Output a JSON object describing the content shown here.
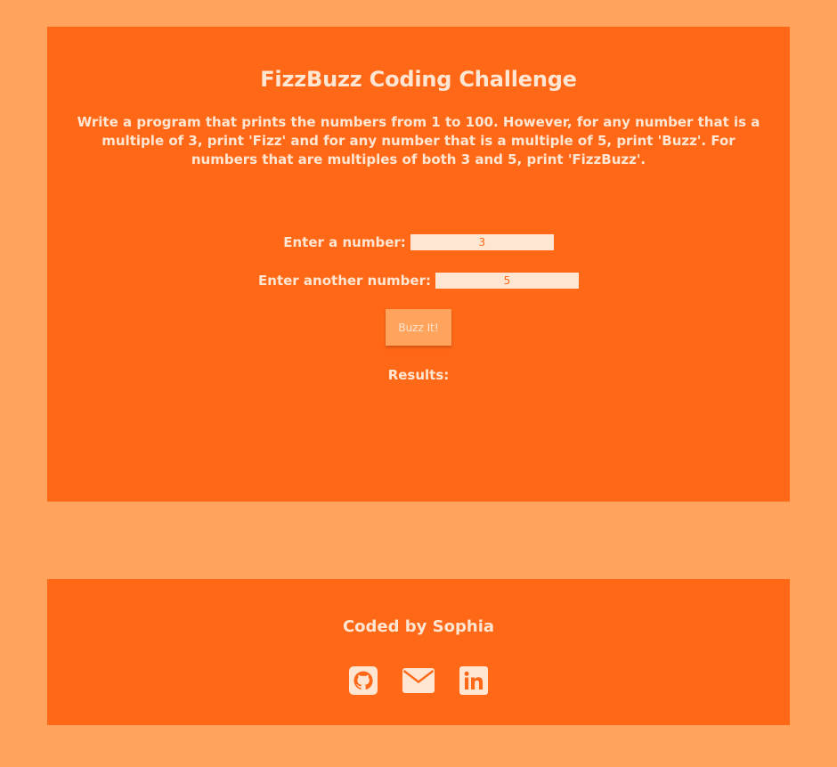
{
  "challenge": {
    "title": "FizzBuzz Coding Challenge",
    "description": "Write a program that prints the numbers from 1 to 100. However, for any number that is a multiple of 3, print 'Fizz' and for any number that is a multiple of 5, print 'Buzz'. For numbers that are multiples of both 3 and 5, print 'FizzBuzz'."
  },
  "form": {
    "first_label": "Enter a number:",
    "first_value": "3",
    "second_label": "Enter another number:",
    "second_value": "5",
    "button_label": "Buzz It!",
    "results_label": "Results:"
  },
  "footer": {
    "credit": "Coded by Sophia",
    "icons": [
      "github-icon",
      "envelope-icon",
      "linkedin-icon"
    ]
  },
  "colors": {
    "page_background": "#ffa35d",
    "card_background": "#ff6817",
    "text": "#ffe6d2",
    "input_background": "#ffe6d2",
    "button_background": "#ffa35d"
  }
}
